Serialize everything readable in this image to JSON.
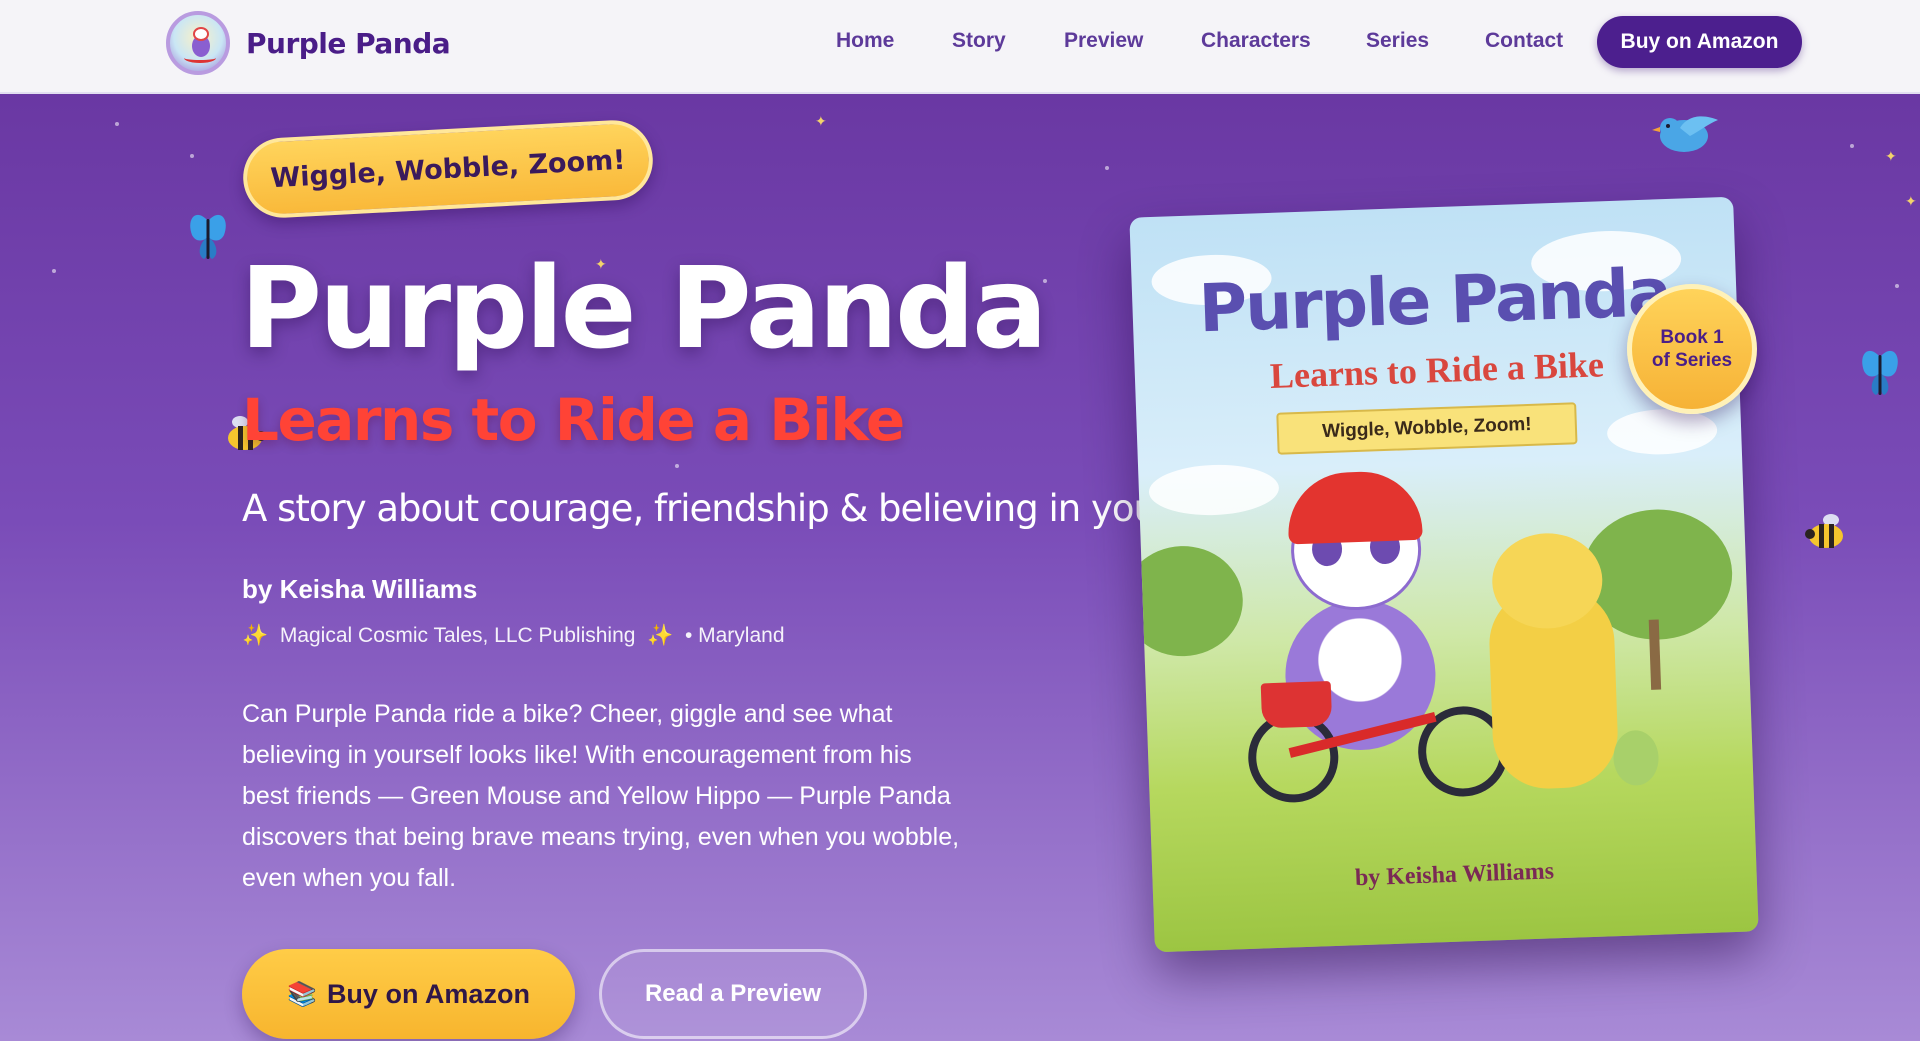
{
  "nav": {
    "brand": "Purple Panda",
    "links": [
      "Home",
      "Story",
      "Preview",
      "Characters",
      "Series",
      "Contact"
    ],
    "cta": "Buy on Amazon"
  },
  "hero": {
    "tagline": "Wiggle, Wobble, Zoom!",
    "title": "Purple Panda",
    "subtitle": "Learns to Ride a Bike",
    "lead": "A story about courage, friendship & believing in yourself",
    "author": "by Keisha Williams",
    "publisher": "Magical Cosmic Tales, LLC Publishing",
    "location": "• Maryland",
    "description": "Can Purple Panda ride a bike? Cheer, giggle and see what believing in yourself looks like! With encouragement from his best friends — Green Mouse and Yellow Hippo — Purple Panda discovers that being brave means trying, even when you wobble, even when you fall.",
    "primary_button": "Buy on Amazon",
    "primary_button_icon": "📚",
    "secondary_button": "Read a Preview"
  },
  "book": {
    "title": "Purple Panda",
    "subtitle": "Learns to Ride a Bike",
    "banner": "Wiggle, Wobble, Zoom!",
    "author": "by Keisha Williams",
    "badge_line1": "Book 1",
    "badge_line2": "of Series"
  },
  "icons": [
    "butterfly-icon",
    "bee-icon",
    "bird-icon",
    "sparkle-icon"
  ],
  "colors": {
    "brand_purple": "#4c1f8e",
    "accent_yellow": "#f7b52e",
    "title_red": "#ff4336",
    "hero_bg": "#6a38a3"
  }
}
